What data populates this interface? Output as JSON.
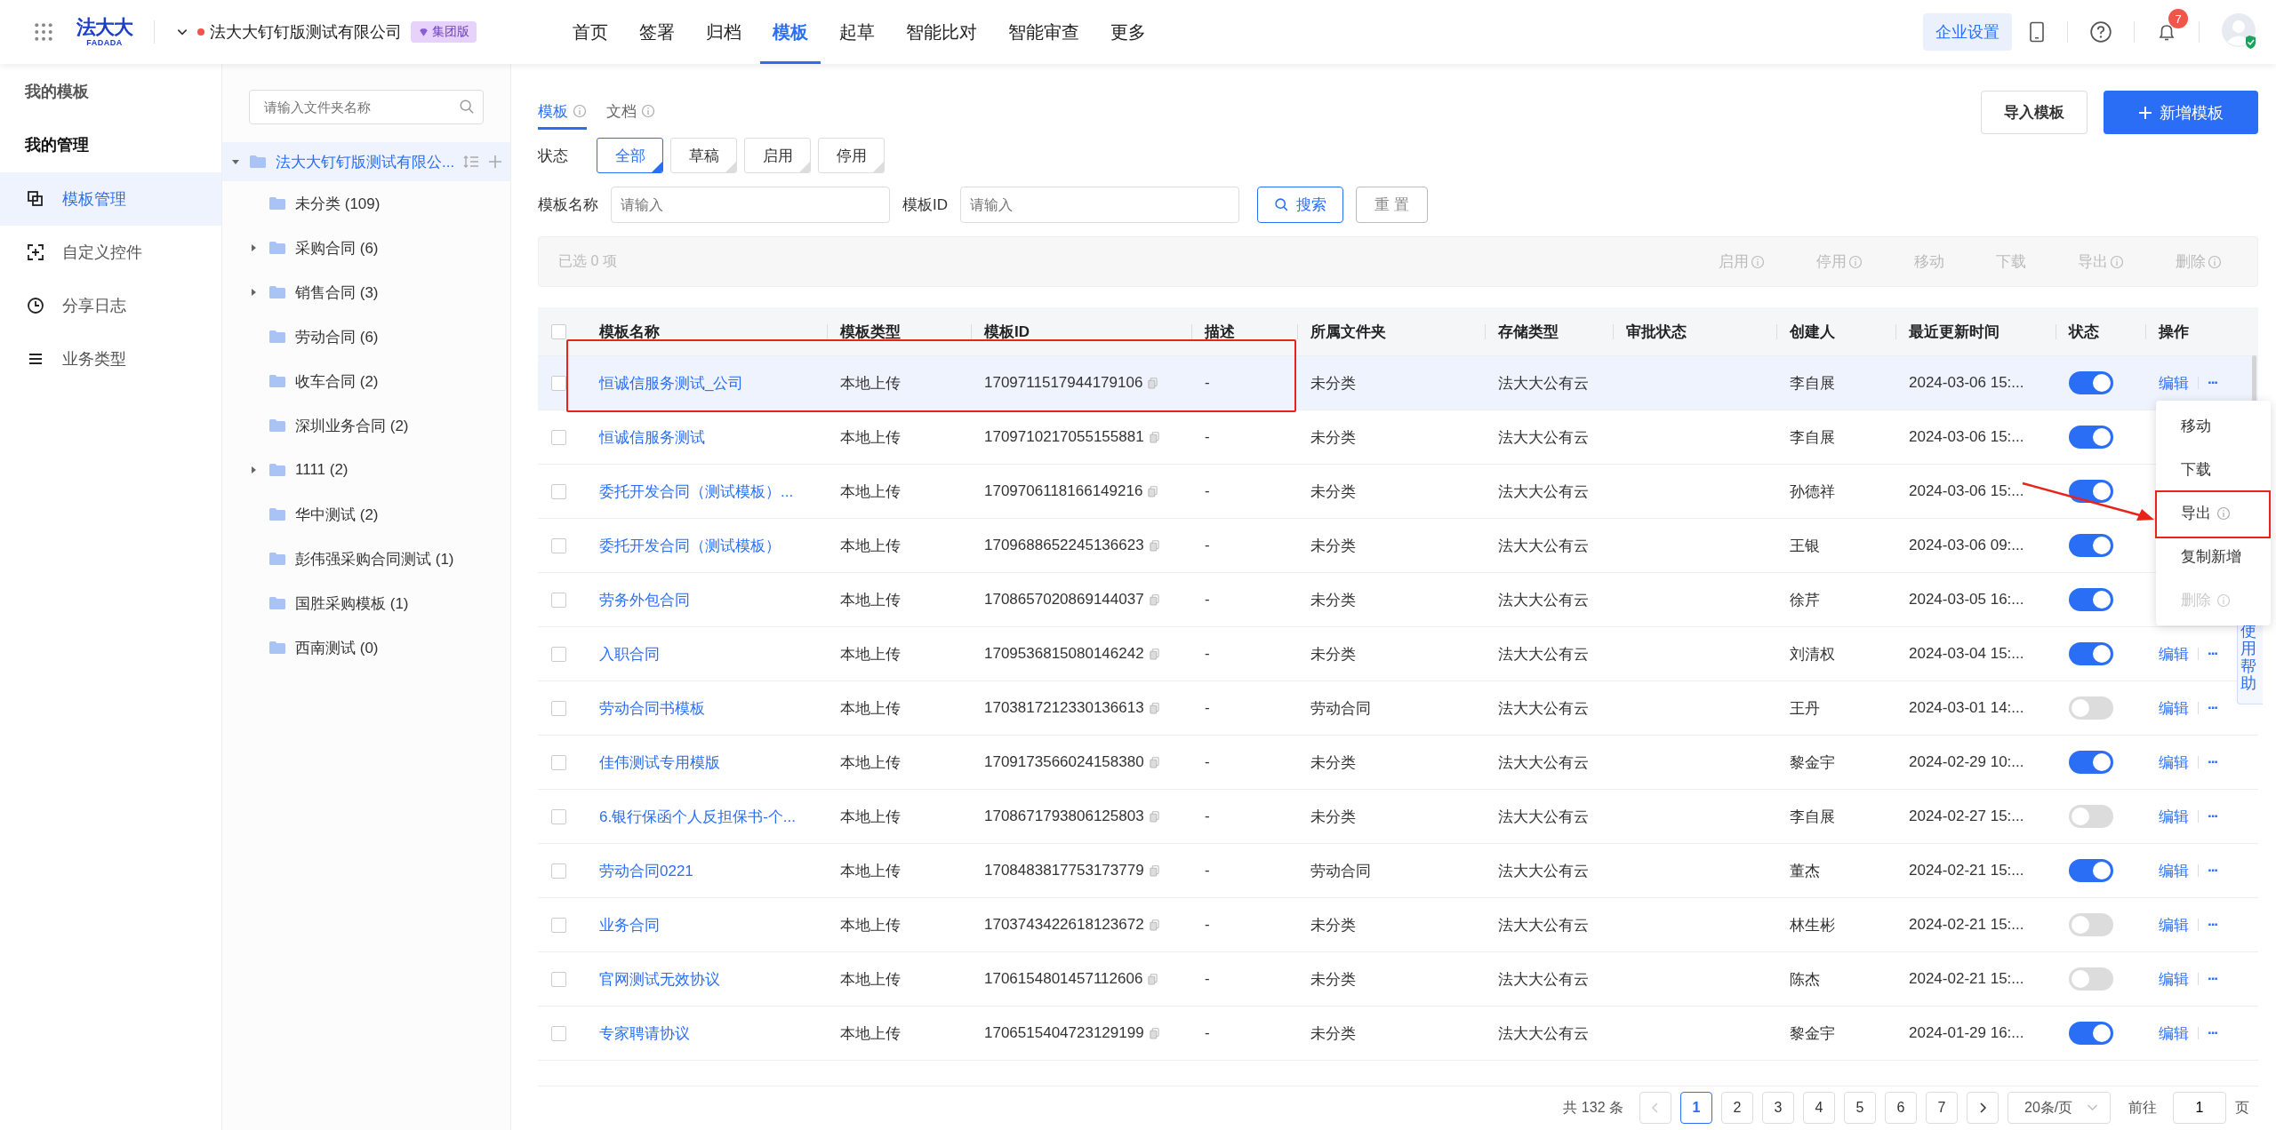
{
  "top_bar": {
    "logo": "法大大",
    "logo_sub": "FADADA",
    "company": "法大大钉钉版测试有限公司",
    "edition_badge": "集团版",
    "nav": [
      {
        "label": "首页",
        "selected": false
      },
      {
        "label": "签署",
        "selected": false
      },
      {
        "label": "归档",
        "selected": false
      },
      {
        "label": "模板",
        "selected": true
      },
      {
        "label": "起草",
        "selected": false
      },
      {
        "label": "智能比对",
        "selected": false
      },
      {
        "label": "智能审查",
        "selected": false
      },
      {
        "label": "更多",
        "selected": false
      }
    ],
    "settings_button": "企业设置",
    "notification_count": "7"
  },
  "sidebar": {
    "section_title": "我的模板",
    "group_title": "我的管理",
    "items": [
      {
        "label": "模板管理",
        "selected": true
      },
      {
        "label": "自定义控件",
        "selected": false
      },
      {
        "label": "分享日志",
        "selected": false
      },
      {
        "label": "业务类型",
        "selected": false
      }
    ]
  },
  "folder_tree": {
    "search_placeholder": "请输入文件夹名称",
    "root": {
      "label": "法大大钉钉版测试有限公...",
      "expanded": true,
      "selected": true,
      "children": [
        {
          "label": "未分类 (109)",
          "expandable": false
        },
        {
          "label": "采购合同 (6)",
          "expandable": true
        },
        {
          "label": "销售合同 (3)",
          "expandable": true
        },
        {
          "label": "劳动合同 (6)",
          "expandable": false
        },
        {
          "label": "收车合同 (2)",
          "expandable": false
        },
        {
          "label": "深圳业务合同 (2)",
          "expandable": false
        },
        {
          "label": "1111 (2)",
          "expandable": true
        },
        {
          "label": "华中测试 (2)",
          "expandable": false
        },
        {
          "label": "彭伟强采购合同测试 (1)",
          "expandable": false
        },
        {
          "label": "国胜采购模板 (1)",
          "expandable": false
        },
        {
          "label": "西南测试 (0)",
          "expandable": false
        }
      ]
    }
  },
  "content_tabs": [
    {
      "label": "模板",
      "info": true,
      "selected": true
    },
    {
      "label": "文档",
      "info": true,
      "selected": false
    }
  ],
  "import_button": "导入模板",
  "add_button": "新增模板",
  "status_filter": {
    "label": "状态",
    "options": [
      {
        "label": "全部",
        "selected": true
      },
      {
        "label": "草稿",
        "selected": false
      },
      {
        "label": "启用",
        "selected": false
      },
      {
        "label": "停用",
        "selected": false
      }
    ]
  },
  "filters": [
    {
      "label": "模板名称",
      "placeholder": "请输入"
    },
    {
      "label": "模板ID",
      "placeholder": "请输入"
    }
  ],
  "search_button": "搜索",
  "reset_button": "重 置",
  "batch_bar": {
    "selected_text": "已选 0 项",
    "actions": [
      {
        "label": "启用",
        "info": true,
        "disabled": true
      },
      {
        "label": "停用",
        "info": true,
        "disabled": true
      },
      {
        "label": "移动",
        "info": false,
        "disabled": true
      },
      {
        "label": "下载",
        "info": false,
        "disabled": true
      },
      {
        "label": "导出",
        "info": true,
        "disabled": true
      },
      {
        "label": "删除",
        "info": true,
        "disabled": true
      }
    ]
  },
  "table": {
    "select_all_checked": false,
    "columns": [
      "模板名称",
      "模板类型",
      "模板ID",
      "描述",
      "所属文件夹",
      "存储类型",
      "审批状态",
      "创建人",
      "最近更新时间",
      "状态",
      "操作"
    ],
    "rows": [
      {
        "name": "恒诚信服务测试_公司",
        "type": "本地上传",
        "id": "1709711517944179106",
        "desc": "-",
        "folder": "未分类",
        "storage": "法大大公有云",
        "creator": "李自展",
        "updated": "2024-03-06 15:...",
        "enabled": true,
        "hovered": true,
        "actions": {
          "edit": "编辑",
          "more": "···"
        }
      },
      {
        "name": "恒诚信服务测试",
        "type": "本地上传",
        "id": "1709710217055155881",
        "desc": "-",
        "folder": "未分类",
        "storage": "法大大公有云",
        "creator": "李自展",
        "updated": "2024-03-06 15:...",
        "enabled": true,
        "hovered": false
      },
      {
        "name": "委托开发合同（测试模板）...",
        "type": "本地上传",
        "id": "1709706118166149216",
        "desc": "-",
        "folder": "未分类",
        "storage": "法大大公有云",
        "creator": "孙德祥",
        "updated": "2024-03-06 15:...",
        "enabled": true,
        "hovered": false
      },
      {
        "name": "委托开发合同（测试模板）",
        "type": "本地上传",
        "id": "1709688652245136623",
        "desc": "-",
        "folder": "未分类",
        "storage": "法大大公有云",
        "creator": "王银",
        "updated": "2024-03-06 09:...",
        "enabled": true,
        "hovered": false
      },
      {
        "name": "劳务外包合同",
        "type": "本地上传",
        "id": "1708657020869144037",
        "desc": "-",
        "folder": "未分类",
        "storage": "法大大公有云",
        "creator": "徐芹",
        "updated": "2024-03-05 16:...",
        "enabled": true,
        "hovered": false
      },
      {
        "name": "入职合同",
        "type": "本地上传",
        "id": "1709536815080146242",
        "desc": "-",
        "folder": "未分类",
        "storage": "法大大公有云",
        "creator": "刘清权",
        "updated": "2024-03-04 15:...",
        "enabled": true,
        "hovered": false,
        "actions": {
          "edit": "编辑",
          "more": "···"
        }
      },
      {
        "name": "劳动合同书模板",
        "type": "本地上传",
        "id": "1703817212330136613",
        "desc": "-",
        "folder": "劳动合同",
        "storage": "法大大公有云",
        "creator": "王丹",
        "updated": "2024-03-01 14:...",
        "enabled": false,
        "hovered": false,
        "actions": {
          "edit": "编辑",
          "more": "···"
        }
      },
      {
        "name": "佳伟测试专用模版",
        "type": "本地上传",
        "id": "1709173566024158380",
        "desc": "-",
        "folder": "未分类",
        "storage": "法大大公有云",
        "creator": "黎金宇",
        "updated": "2024-02-29 10:...",
        "enabled": true,
        "hovered": false,
        "actions": {
          "edit": "编辑",
          "more": "···"
        }
      },
      {
        "name": "6.银行保函个人反担保书-个...",
        "type": "本地上传",
        "id": "1708671793806125803",
        "desc": "-",
        "folder": "未分类",
        "storage": "法大大公有云",
        "creator": "李自展",
        "updated": "2024-02-27 15:...",
        "enabled": false,
        "hovered": false,
        "actions": {
          "edit": "编辑",
          "more": "···"
        }
      },
      {
        "name": "劳动合同0221",
        "type": "本地上传",
        "id": "1708483817753173779",
        "desc": "-",
        "folder": "劳动合同",
        "storage": "法大大公有云",
        "creator": "董杰",
        "updated": "2024-02-21 15:...",
        "enabled": true,
        "hovered": false,
        "actions": {
          "edit": "编辑",
          "more": "···"
        }
      },
      {
        "name": "业务合同",
        "type": "本地上传",
        "id": "1703743422618123672",
        "desc": "-",
        "folder": "未分类",
        "storage": "法大大公有云",
        "creator": "林生彬",
        "updated": "2024-02-21 15:...",
        "enabled": false,
        "hovered": false,
        "actions": {
          "edit": "编辑",
          "more": "···"
        }
      },
      {
        "name": "官网测试无效协议",
        "type": "本地上传",
        "id": "1706154801457112606",
        "desc": "-",
        "folder": "未分类",
        "storage": "法大大公有云",
        "creator": "陈杰",
        "updated": "2024-02-21 15:...",
        "enabled": false,
        "hovered": false,
        "actions": {
          "edit": "编辑",
          "more": "···"
        }
      },
      {
        "name": "专家聘请协议",
        "type": "本地上传",
        "id": "1706515404723129199",
        "desc": "-",
        "folder": "未分类",
        "storage": "法大大公有云",
        "creator": "黎金宇",
        "updated": "2024-01-29 16:...",
        "enabled": true,
        "hovered": false,
        "actions": {
          "edit": "编辑",
          "more": "···"
        }
      }
    ]
  },
  "context_menu": {
    "items": [
      {
        "label": "移动",
        "info": false,
        "disabled": false
      },
      {
        "label": "下载",
        "info": false,
        "disabled": false
      },
      {
        "label": "导出",
        "info": true,
        "disabled": false
      },
      {
        "label": "复制新增",
        "info": false,
        "disabled": false
      },
      {
        "label": "删除",
        "info": true,
        "disabled": true
      }
    ]
  },
  "help_tab": "使用帮助",
  "pagination": {
    "total": "共 132 条",
    "prev_disabled": true,
    "next_disabled": false,
    "pages": [
      {
        "label": "1",
        "selected": true
      },
      {
        "label": "2",
        "selected": false
      },
      {
        "label": "3",
        "selected": false
      },
      {
        "label": "4",
        "selected": false
      },
      {
        "label": "5",
        "selected": false
      },
      {
        "label": "6",
        "selected": false
      },
      {
        "label": "7",
        "selected": false
      }
    ],
    "page_size": "20条/页",
    "goto_label": "前往",
    "goto_value": "1",
    "page_unit": "页"
  }
}
